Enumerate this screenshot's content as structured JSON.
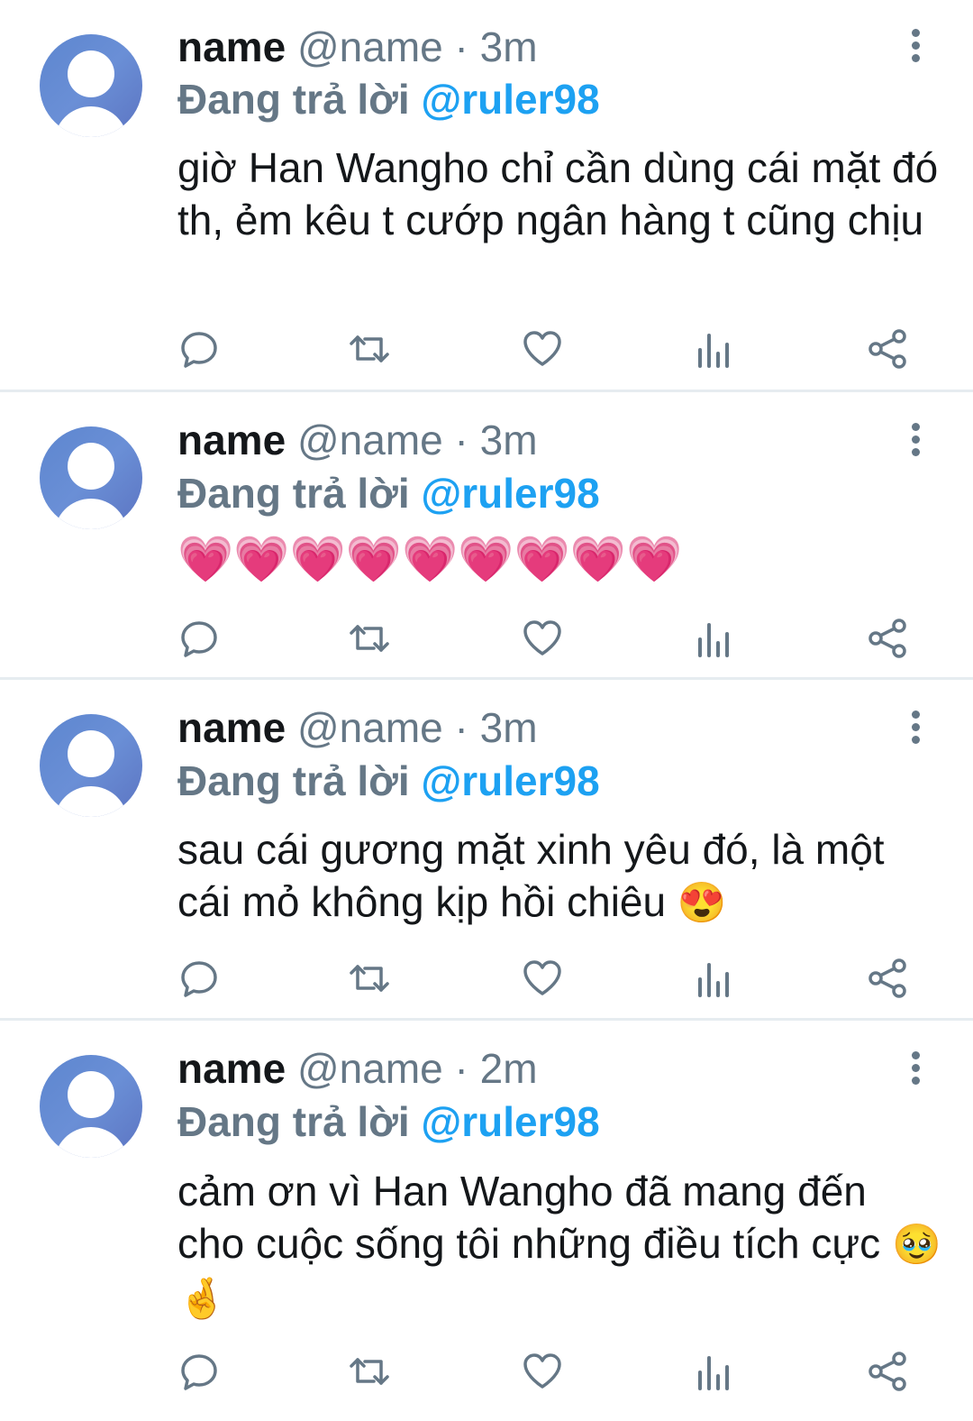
{
  "colors": {
    "name": "#14171a",
    "handle": "#657786",
    "mention": "#1da1f2",
    "icon": "#657786",
    "separator": "#e6ecf0"
  },
  "tweets": [
    {
      "name": "name",
      "handle": "@name",
      "dot": "·",
      "time": "3m",
      "reply_prefix": "Đang trả lời",
      "reply_to": "@ruler98",
      "text": "giờ Han Wangho chỉ cần dùng cái mặt đó th, ẻm kêu t cướp ngân hàng t cũng chịu",
      "emojis": ""
    },
    {
      "name": "name",
      "handle": "@name",
      "dot": "·",
      "time": "3m",
      "reply_prefix": "Đang trả lời",
      "reply_to": "@ruler98",
      "text": "",
      "emojis": "💗💗💗💗💗💗💗💗💗"
    },
    {
      "name": "name",
      "handle": "@name",
      "dot": "·",
      "time": "3m",
      "reply_prefix": "Đang trả lời",
      "reply_to": "@ruler98",
      "text": "sau cái gương mặt xinh yêu đó, là một cái mỏ không kịp hồi chiêu",
      "emojis": "😍"
    },
    {
      "name": "name",
      "handle": "@name",
      "dot": "·",
      "time": "2m",
      "reply_prefix": "Đang trả lời",
      "reply_to": "@ruler98",
      "text": "cảm ơn vì Han Wangho đã mang đến cho cuộc sống tôi những điều tích cực",
      "emojis": "🥹🤞"
    }
  ],
  "action_icons": [
    "reply-icon",
    "retweet-icon",
    "like-icon",
    "analytics-icon",
    "share-icon"
  ]
}
